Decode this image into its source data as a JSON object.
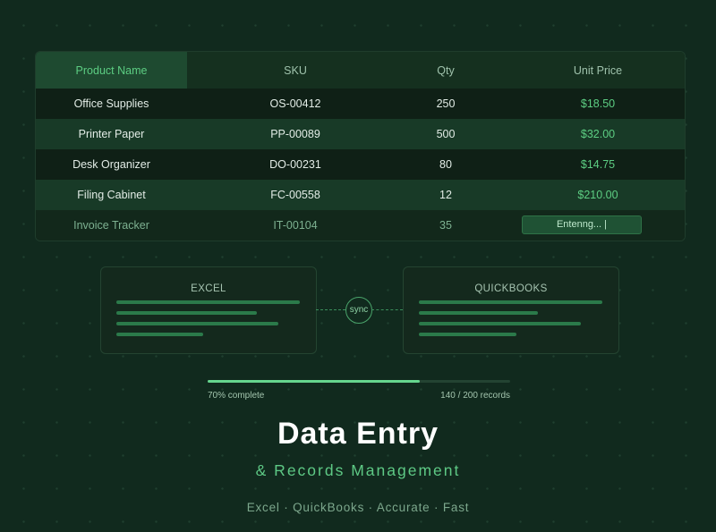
{
  "table": {
    "headers": [
      "Product Name",
      "SKU",
      "Qty",
      "Unit Price"
    ],
    "rows": [
      {
        "name": "Office Supplies",
        "sku": "OS-00412",
        "qty": "250",
        "price": "$18.50"
      },
      {
        "name": "Printer Paper",
        "sku": "PP-00089",
        "qty": "500",
        "price": "$32.00"
      },
      {
        "name": "Desk Organizer",
        "sku": "DO-00231",
        "qty": "80",
        "price": "$14.75"
      },
      {
        "name": "Filing Cabinet",
        "sku": "FC-00558",
        "qty": "12",
        "price": "$210.00"
      },
      {
        "name": "Invoice Tracker",
        "sku": "IT-00104",
        "qty": "35",
        "price_entry": "Entenng... |"
      }
    ]
  },
  "sync": {
    "left_title": "EXCEL",
    "right_title": "QUICKBOOKS",
    "badge": "sync"
  },
  "progress": {
    "fraction": 0.7,
    "label_left": "70% complete",
    "label_right": "140 / 200 records"
  },
  "hero": {
    "title": "Data Entry",
    "subtitle": "& Records Management",
    "tagline": "Excel · QuickBooks · Accurate · Fast"
  },
  "colors": {
    "background": "#112a1e",
    "accent": "#5ccd82",
    "active_header": "#1e4a30"
  }
}
